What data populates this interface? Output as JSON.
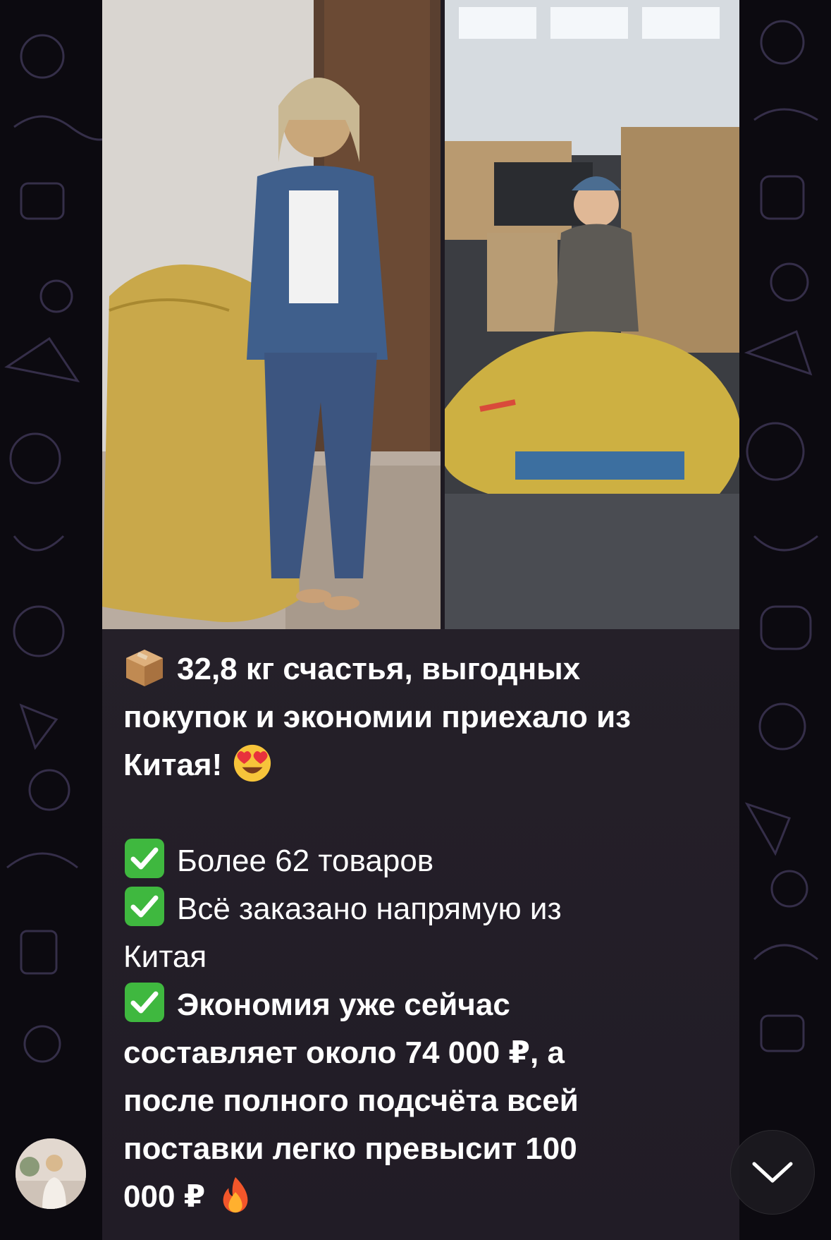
{
  "post": {
    "line1": "32,8 кг счастья, выгодных",
    "line2": "покупок и экономии приехало из",
    "line3": "Китая!",
    "item1": "Более 62 товаров",
    "item2a": "Всё заказано напрямую из",
    "item2b": "Китая",
    "item3a": "Экономия уже сейчас",
    "item3b": "составляет около 74 000 ₽, а",
    "item3c": "после полного подсчёта всей",
    "item3d": "поставки легко превысит 100",
    "item3e": "000 ₽"
  },
  "icons": {
    "package": "package-icon",
    "heart_eyes": "heart-eyes-emoji",
    "check": "check-mark-button-icon",
    "fire": "fire-emoji",
    "scroll_down": "chevron-down-icon"
  },
  "colors": {
    "bubble": "#252029",
    "check_green": "#3fb83f",
    "text": "#ffffff"
  }
}
